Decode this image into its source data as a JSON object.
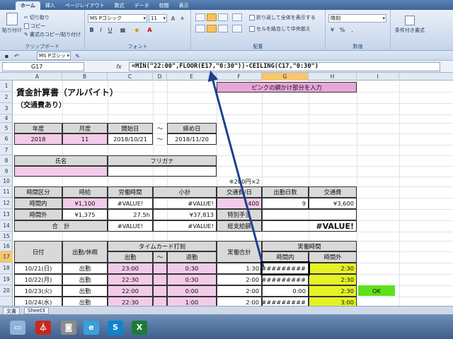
{
  "ribbon": {
    "tabs": [
      "ホーム",
      "挿入",
      "ページレイアウト",
      "数式",
      "データ",
      "校閲",
      "表示"
    ],
    "clipboard": {
      "paste": "貼り付け",
      "cut": "切り取り",
      "copy": "コピー",
      "format_painter": "書式のコピー/貼り付け",
      "label": "クリップボード"
    },
    "font": {
      "name": "MS Pゴシック",
      "size": "11",
      "label": "フォント"
    },
    "alignment": {
      "wrap": "折り返して全体を表示する",
      "merge": "セルを結合して中央揃え",
      "label": "配置"
    },
    "number": {
      "format": "時刻",
      "label": "数値"
    },
    "conditional": "条件付き書式"
  },
  "qat": {
    "font": "MS Pゴシッ"
  },
  "formula_bar": {
    "name_box": "G17",
    "fx": "fx",
    "formula": "=MIN(\"22:00\",FLOOR(E17,\"0:30\"))-CEILING(C17,\"0:30\")"
  },
  "columns": [
    "A",
    "B",
    "C",
    "D",
    "E",
    "F",
    "G",
    "H",
    "I"
  ],
  "rows": [
    "1",
    "2",
    "3",
    "4",
    "5",
    "6",
    "7",
    "8",
    "9",
    "10",
    "11",
    "12",
    "13",
    "14",
    "15",
    "16",
    "17",
    "18",
    "19",
    "20"
  ],
  "sheet": {
    "title": "賃金計算書（アルバイト）",
    "subtitle": "（交通費あり）",
    "note": "ピンクの網かけ部分を入力",
    "period": {
      "year_label": "年度",
      "month_label": "月度",
      "start_label": "開始日",
      "tilde": "〜",
      "end_label": "締め日",
      "year": "2018",
      "month": "11",
      "start": "2018/10/21",
      "end": "2018/11/20"
    },
    "name": {
      "label": "氏名",
      "furigana_label": "フリガナ"
    },
    "fare_note": "※200円×2",
    "summary": {
      "h_class": "時間区分",
      "h_rate": "時給",
      "h_hours": "労働時間",
      "h_subtotal": "小計",
      "h_fare": "交通費/日",
      "h_days": "出勤日数",
      "h_transport": "交通費",
      "r1_label": "時間内",
      "r1_rate": "¥1,100",
      "r1_hours": "#VALUE!",
      "r1_sub": "#VALUE!",
      "r1_fare": "400",
      "r1_days": "9",
      "r1_transport": "¥3,600",
      "r2_label": "時間外",
      "r2_rate": "¥1,375",
      "r2_hours": "27.5h",
      "r2_sub": "¥37,813",
      "r2_special": "特別手当",
      "total_label": "合　計",
      "total_hours": "#VALUE!",
      "total_sub": "#VALUE!",
      "grand_label": "総支給額",
      "grand": "#VALUE!"
    },
    "time_header": {
      "date": "日付",
      "attend": "出勤/休暇",
      "timecard": "タイムカード打刻",
      "in": "出勤",
      "tilde": "〜",
      "out": "退勤",
      "total": "実働合計",
      "actual": "実働時間",
      "within": "時間内",
      "overtime": "時間外"
    },
    "time_rows": [
      {
        "date": "10/21(日)",
        "status": "出勤",
        "in": "23:00",
        "out": "0:30",
        "total": "1:30",
        "within": "###########",
        "over": "2:30"
      },
      {
        "date": "10/22(月)",
        "status": "出勤",
        "in": "22:30",
        "out": "0:30",
        "total": "2:00",
        "within": "###########",
        "over": "2:30"
      },
      {
        "date": "10/23(火)",
        "status": "出勤",
        "in": "22:00",
        "out": "0:00",
        "total": "2:00",
        "within": "0:00",
        "over": "2:30"
      },
      {
        "date": "10/24(水)",
        "status": "出勤",
        "in": "22:30",
        "out": "1:00",
        "total": "2:00",
        "within": "###########",
        "over": "3:00"
      }
    ],
    "ok": "OK"
  },
  "sheet_tabs": [
    "文書",
    "Sheet3"
  ],
  "taskbar": {
    "colors": {
      "pdf": "#c8281e",
      "ie": "#3aa0d8",
      "skype": "#0c84cf",
      "excel": "#1f7a3a"
    }
  }
}
